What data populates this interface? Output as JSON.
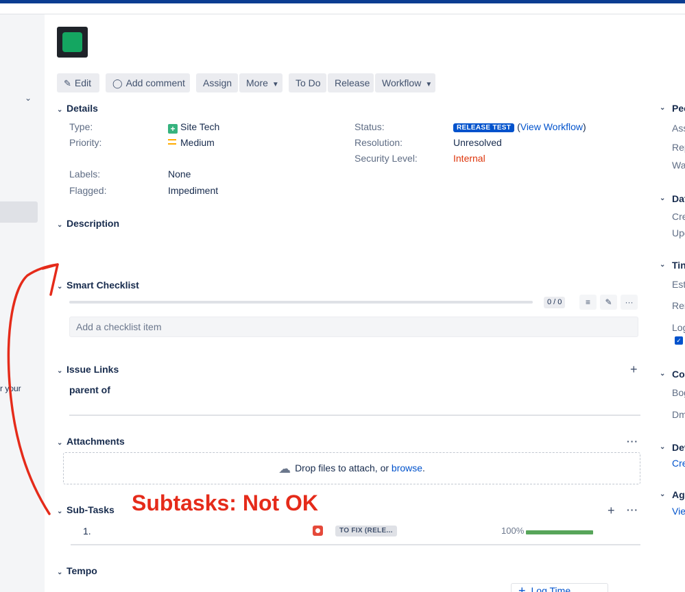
{
  "toolbar": {
    "edit": "Edit",
    "add_comment": "Add comment",
    "assign": "Assign",
    "more": "More",
    "todo": "To Do",
    "release": "Release",
    "workflow": "Workflow"
  },
  "details": {
    "heading": "Details",
    "type_label": "Type:",
    "type_value": "Site Tech",
    "priority_label": "Priority:",
    "priority_value": "Medium",
    "labels_label": "Labels:",
    "labels_value": "None",
    "flagged_label": "Flagged:",
    "flagged_value": "Impediment",
    "status_label": "Status:",
    "status_badge": "RELEASE TEST",
    "status_link_open": "(",
    "status_link": "View Workflow",
    "status_link_close": ")",
    "resolution_label": "Resolution:",
    "resolution_value": "Unresolved",
    "security_label": "Security Level:",
    "security_value": "Internal"
  },
  "description": {
    "heading": "Description"
  },
  "smart_checklist": {
    "heading": "Smart Checklist",
    "count": "0 / 0",
    "placeholder": "Add a checklist item"
  },
  "issue_links": {
    "heading": "Issue Links",
    "relation": "parent of"
  },
  "attachments": {
    "heading": "Attachments",
    "drop_text": "Drop files to attach, or ",
    "browse": "browse",
    "period": "."
  },
  "subtasks": {
    "heading": "Sub-Tasks",
    "annotation": "Subtasks: Not OK",
    "rows": [
      {
        "num": "1.",
        "status": "TO FIX (RELE...",
        "percent": "100%",
        "progress": 1.0
      }
    ]
  },
  "tempo": {
    "heading": "Tempo",
    "log_time": "Log Time"
  },
  "left_panel": {
    "partial_text": "r your"
  },
  "right_sidebar": {
    "people_head": "Peo",
    "assignee": "Ass",
    "reporter": "Rep",
    "watchers": "Wa",
    "dates_head": "Dat",
    "created": "Cre",
    "updated": "Upo",
    "time_head": "Tin",
    "estimated": "Est",
    "remaining": "Rer",
    "logged": "Log",
    "collab_head": "Col",
    "bog": "Bog",
    "dm": "Dm",
    "dev_head": "Dev",
    "create_link": "Cre",
    "agile_head": "Agi",
    "view_link": "Vie"
  },
  "colors": {
    "brand_blue": "#0052cc",
    "topbar": "#0b3d91",
    "annotation_red": "#e52b1a",
    "issue_green": "#14a661",
    "progress_green": "#57a55a"
  }
}
